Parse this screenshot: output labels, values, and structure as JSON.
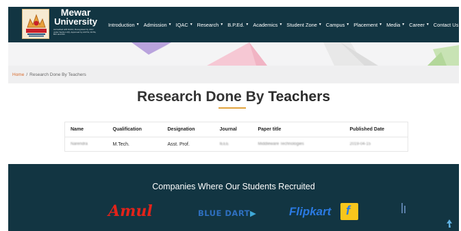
{
  "header": {
    "logo": {
      "name_line1": "Mewar",
      "name_line2": "University",
      "fine_print": "Accredited with NAAC, Recognised by UGC under Section 2(f), Approved by AICTE, NCTE, BCI and INC"
    },
    "nav": [
      {
        "label": "Introduction",
        "has_menu": true
      },
      {
        "label": "Admission",
        "has_menu": true
      },
      {
        "label": "IQAC",
        "has_menu": true
      },
      {
        "label": "Research",
        "has_menu": true
      },
      {
        "label": "B.P.Ed.",
        "has_menu": true
      },
      {
        "label": "Academics",
        "has_menu": true
      },
      {
        "label": "Student Zone",
        "has_menu": true
      },
      {
        "label": "Campus",
        "has_menu": true
      },
      {
        "label": "Placement",
        "has_menu": true
      },
      {
        "label": "Media",
        "has_menu": true
      },
      {
        "label": "Career",
        "has_menu": true
      },
      {
        "label": "Contact Us",
        "has_menu": true
      }
    ],
    "background": "#123542"
  },
  "breadcrumb": {
    "home": "Home",
    "separator": "/",
    "current": "Research Done By Teachers"
  },
  "page_title": {
    "part1": "Research",
    "part2": "Done",
    "part3": "By",
    "part4": "Teachers"
  },
  "table": {
    "columns": [
      "Name",
      "Qualification",
      "Designation",
      "Journal",
      "Paper title",
      "Published Date"
    ],
    "rows": [
      [
        "Narendra",
        "M.Tech.",
        "Asst. Prof.",
        "IEEE",
        "Middleware Technologies",
        "2019-04-15"
      ]
    ]
  },
  "companies": {
    "title": "Companies Where Our Students Recruited",
    "logos": [
      {
        "name": "Amul",
        "color": "#e2231a"
      },
      {
        "name": "BLUE DART",
        "color": "#2e6fbf"
      },
      {
        "name": "Flipkart",
        "color": "#2a7ae2"
      }
    ]
  },
  "colors": {
    "accent": "#d86a2a",
    "underline": "#e0a23c",
    "dark_teal": "#123542"
  },
  "icons": {
    "scroll_top": "arrow-up-icon",
    "nav_caret": "caret-down-icon"
  }
}
